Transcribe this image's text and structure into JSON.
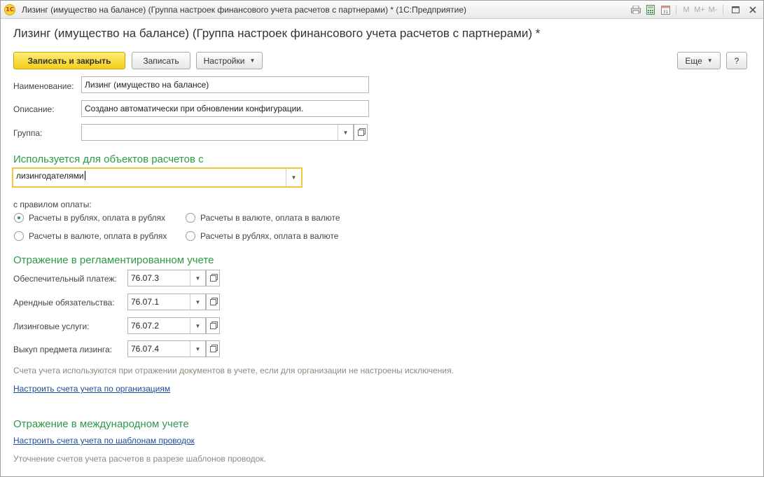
{
  "window": {
    "title": "Лизинг (имущество на балансе) (Группа настроек финансового учета расчетов с партнерами) * (1С:Предприятие)",
    "logo_text": "1С",
    "memory_buttons": [
      "M",
      "M+",
      "M-"
    ]
  },
  "form": {
    "title": "Лизинг (имущество на балансе) (Группа настроек финансового учета расчетов с партнерами) *"
  },
  "toolbar": {
    "save_close_label": "Записать и закрыть",
    "save_label": "Записать",
    "settings_label": "Настройки",
    "more_label": "Еще",
    "help_label": "?"
  },
  "fields": {
    "name_label": "Наименование:",
    "name_value": "Лизинг (имущество на балансе)",
    "description_label": "Описание:",
    "description_value": "Создано автоматически при обновлении конфигурации.",
    "group_label": "Группа:",
    "group_value": ""
  },
  "usage": {
    "heading": "Используется для объектов расчетов с",
    "value": "лизингодателями",
    "payment_rule_label": "с правилом оплаты:",
    "options": [
      {
        "label": "Расчеты в рублях, оплата в рублях",
        "selected": true
      },
      {
        "label": "Расчеты в валюте, оплата в валюте",
        "selected": false
      },
      {
        "label": "Расчеты в валюте, оплата в рублях",
        "selected": false
      },
      {
        "label": "Расчеты в рублях, оплата в валюте",
        "selected": false
      }
    ]
  },
  "regulated": {
    "heading": "Отражение в регламентированном учете",
    "accounts": [
      {
        "label": "Обеспечительный платеж:",
        "value": "76.07.3"
      },
      {
        "label": "Арендные обязательства:",
        "value": "76.07.1"
      },
      {
        "label": "Лизинговые услуги:",
        "value": "76.07.2"
      },
      {
        "label": "Выкуп предмета лизинга:",
        "value": "76.07.4"
      }
    ],
    "hint": "Счета учета используются при отражении документов в учете, если для организации не настроены исключения.",
    "link": "Настроить счета учета по организациям"
  },
  "international": {
    "heading": "Отражение в международном учете",
    "link": "Настроить счета учета по шаблонам проводок",
    "hint": "Уточнение счетов учета расчетов в разрезе шаблонов проводок."
  },
  "colors": {
    "accent_green": "#2d9a48",
    "primary_button": "#f5cf15",
    "focus_border": "#f2c73f",
    "link": "#1a4d9a"
  }
}
